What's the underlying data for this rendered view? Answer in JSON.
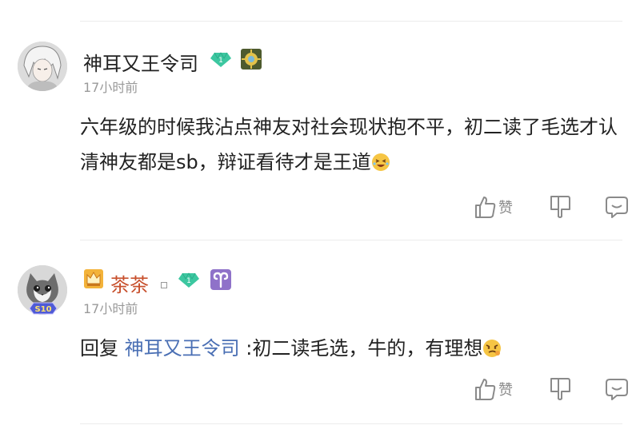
{
  "comments": [
    {
      "username": "神耳又王令司",
      "level": "1",
      "time": "17小时前",
      "content": "六年级的时候我沾点神友对社会现状抱不平，初二读了毛选才认清神友都是sb，辩证看待才是王道",
      "like_label": "赞",
      "avatar_icon": "anime-avatar-icon",
      "emoji_icon": "laughing-emoji-icon"
    },
    {
      "username": "茶茶",
      "level": "1",
      "time": "17小时前",
      "reply_prefix": "回复",
      "reply_to": "神耳又王令司",
      "reply_text": ":初二读毛选，牛的，有理想",
      "like_label": "赞",
      "avatar_badge": "S10",
      "avatar_icon": "cat-avatar-icon",
      "emoji_icon": "smirk-emoji-icon",
      "zodiac_icon": "aries-icon"
    }
  ],
  "colors": {
    "level_gem": "#3cc7a0",
    "highlight_name": "#c8512e",
    "reply_link": "#4a6fb4",
    "zodiac_bg": "#8f72c9"
  }
}
